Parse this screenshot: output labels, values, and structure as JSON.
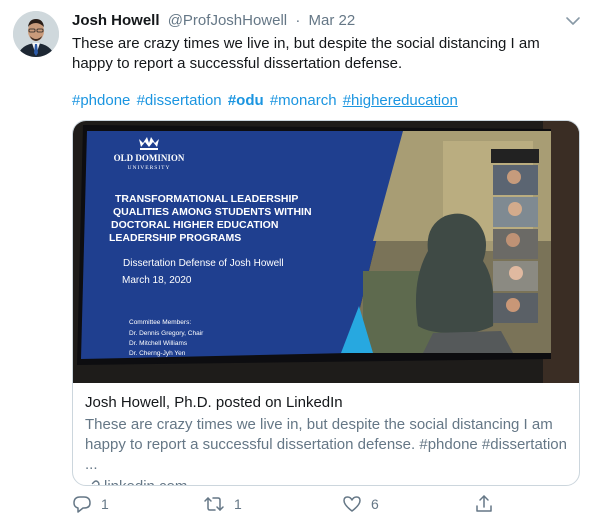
{
  "tweet": {
    "author_name": "Josh Howell",
    "handle": "@ProfJoshHowell",
    "separator": "·",
    "date": "Mar 22",
    "text": "These are crazy times we live in, but despite the social distancing I am happy to report a successful dissertation defense.",
    "hashtags": [
      "#phdone",
      "#dissertation",
      "#odu",
      "#monarch",
      "#highereducation"
    ]
  },
  "card": {
    "slide": {
      "university_line1": "OLD DOMINION",
      "university_line2": "UNIVERSITY",
      "title_lines": [
        "TRANSFORMATIONAL LEADERSHIP",
        "QUALITIES AMONG STUDENTS WITHIN",
        "DOCTORAL HIGHER EDUCATION",
        "LEADERSHIP PROGRAMS"
      ],
      "subtitle": "Dissertation Defense of Josh Howell",
      "date": "March 18, 2020",
      "committee_heading": "Committee Members:",
      "committee": [
        "Dr. Dennis Gregory, Chair",
        "Dr. Mitchell Williams",
        "Dr. Cherng-Jyh Yen"
      ]
    },
    "title": "Josh Howell, Ph.D. posted on LinkedIn",
    "description": "These are crazy times we live in, but despite the social distancing I am happy to report a successful dissertation defense. #phdone #dissertation ...",
    "link": "linkedin.com"
  },
  "actions": {
    "reply_count": "1",
    "retweet_count": "1",
    "like_count": "6"
  },
  "colors": {
    "link": "#1b95e0",
    "muted": "#657786",
    "slide_blue": "#1f3f8f"
  }
}
